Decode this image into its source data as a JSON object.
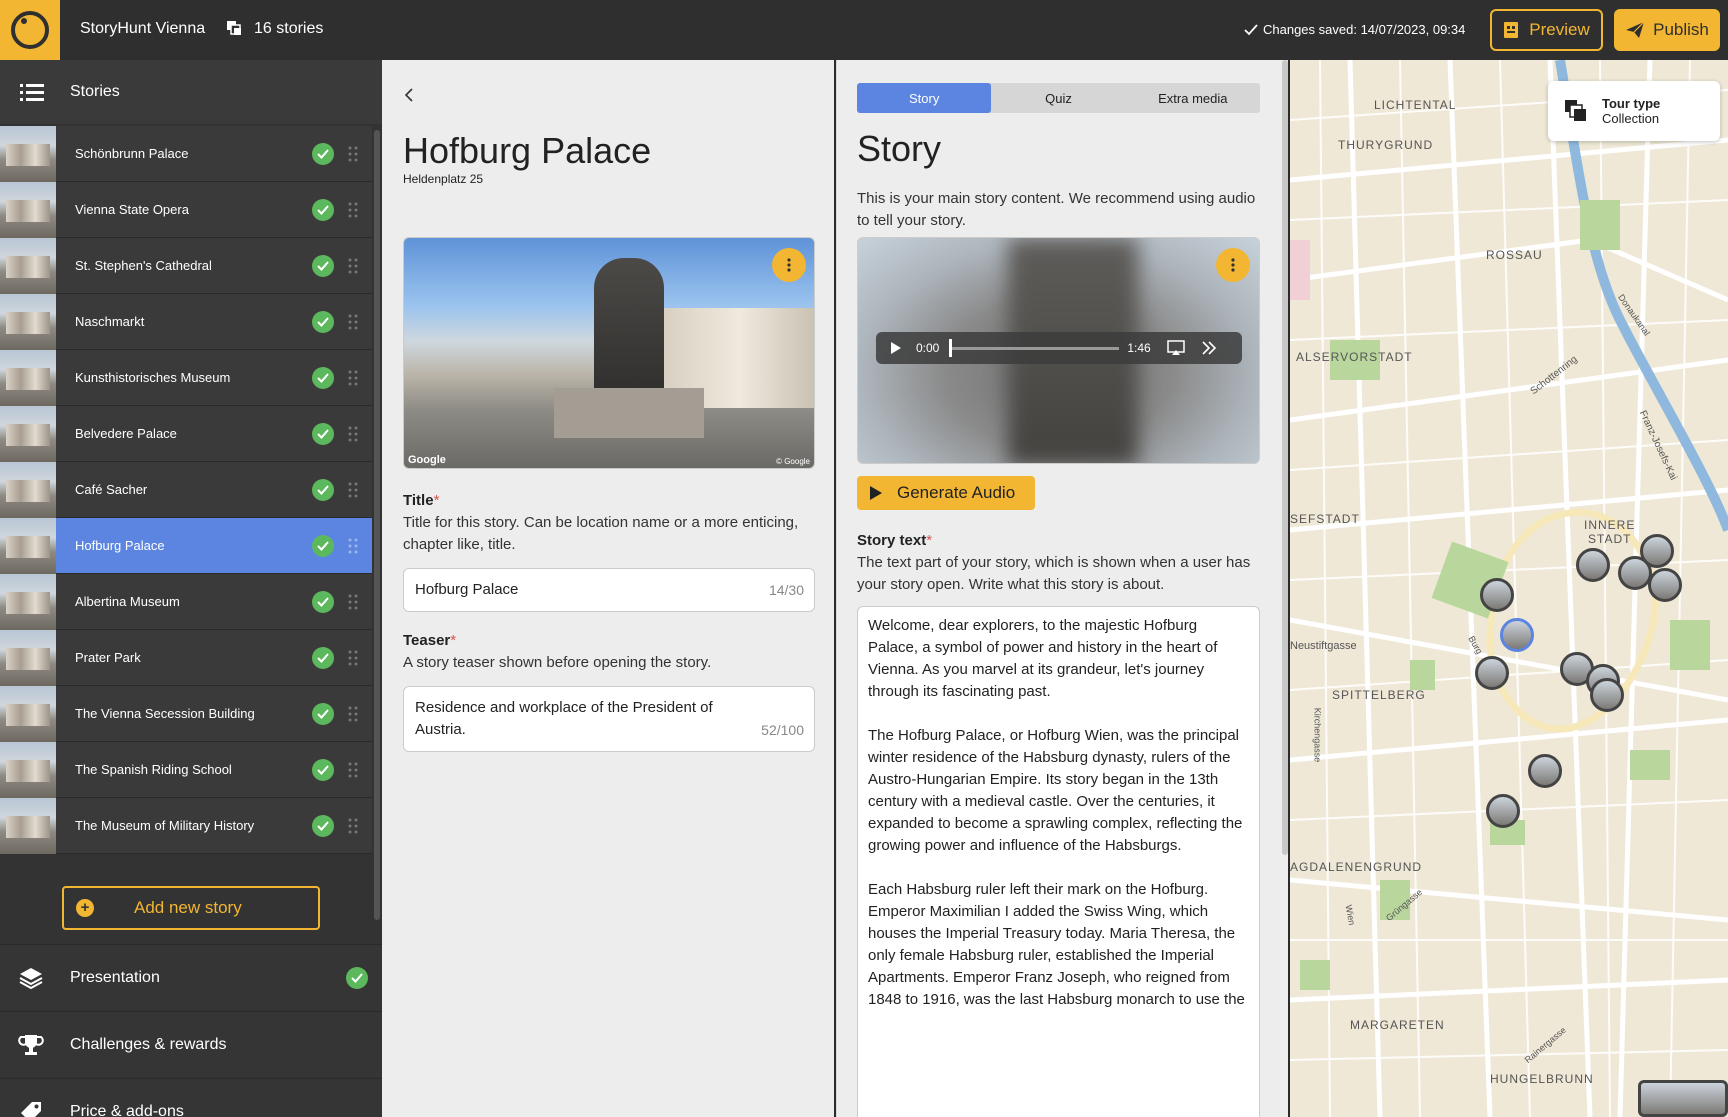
{
  "topbar": {
    "app_title": "StoryHunt Vienna",
    "stories_count": "16 stories",
    "saved_status": "Changes saved: 14/07/2023, 09:34",
    "preview_label": "Preview",
    "publish_label": "Publish",
    "accent_color": "#f2b632"
  },
  "sidebar": {
    "header": "Stories",
    "stories": [
      {
        "name": "Schönbrunn Palace",
        "active": false
      },
      {
        "name": "Vienna State Opera",
        "active": false
      },
      {
        "name": "St. Stephen's Cathedral",
        "active": false
      },
      {
        "name": "Naschmarkt",
        "active": false
      },
      {
        "name": "Kunsthistorisches Museum",
        "active": false
      },
      {
        "name": "Belvedere Palace",
        "active": false
      },
      {
        "name": "Café Sacher",
        "active": false
      },
      {
        "name": "Hofburg Palace",
        "active": true
      },
      {
        "name": "Albertina Museum",
        "active": false
      },
      {
        "name": "Prater Park",
        "active": false
      },
      {
        "name": "The Vienna Secession Building",
        "active": false
      },
      {
        "name": "The Spanish Riding School",
        "active": false
      },
      {
        "name": "The Museum of Military History",
        "active": false
      }
    ],
    "add_story_label": "Add new story",
    "sections": [
      {
        "label": "Presentation",
        "icon": "layers-icon",
        "done": true
      },
      {
        "label": "Challenges & rewards",
        "icon": "trophy-icon",
        "done": false
      },
      {
        "label": "Price & add-ons",
        "icon": "tag-icon",
        "done": false
      }
    ]
  },
  "editor": {
    "title": "Hofburg Palace",
    "address": "Heldenplatz 25",
    "photo_credit": "Google",
    "photo_copyright": "© Google",
    "title_field": {
      "label": "Title",
      "help": "Title for this story. Can be location name or a more enticing, chapter like, title.",
      "value": "Hofburg Palace",
      "counter": "14/30"
    },
    "teaser_field": {
      "label": "Teaser",
      "help": "A story teaser shown before opening the story.",
      "value": "Residence and workplace of the President of Austria.",
      "counter": "52/100"
    }
  },
  "story": {
    "tabs": [
      "Story",
      "Quiz",
      "Extra media"
    ],
    "active_tab": "Story",
    "heading": "Story",
    "help": "This is your main story content. We recommend using audio to tell your story.",
    "player": {
      "current": "0:00",
      "duration": "1:46"
    },
    "generate_audio_label": "Generate Audio",
    "text_field": {
      "label": "Story text",
      "help": "The text part of your story, which is shown when a user has your story open. Write what this story is about.",
      "paragraphs": [
        "Welcome, dear explorers, to the majestic Hofburg Palace, a symbol of power and history in the heart of Vienna. As you marvel at its grandeur, let's journey through its fascinating past.",
        "The Hofburg Palace, or Hofburg Wien, was the principal winter residence of the Habsburg dynasty, rulers of the Austro-Hungarian Empire. Its story began in the 13th century with a medieval castle. Over the centuries, it expanded to become a sprawling complex, reflecting the growing power and influence of the Habsburgs.",
        "Each Habsburg ruler left their mark on the Hofburg. Emperor Maximilian I added the Swiss Wing, which houses the Imperial Treasury today. Maria Theresa, the only female Habsburg ruler, established the Imperial Apartments. Emperor Franz Joseph, who reigned from 1848 to 1916, was the last Habsburg monarch to use the"
      ]
    }
  },
  "map": {
    "tour_type_label": "Tour type",
    "tour_type_value": "Collection",
    "districts": [
      "LICHTENTAL",
      "THURYGRUND",
      "ROSSAU",
      "ALSERVORSTADT",
      "SEFSTADT",
      "INNERE",
      "STADT",
      "SPITTELBERG",
      "AGDALENENGRUND",
      "MARGARETEN",
      "HUNGELBRUNN",
      "Neustiftgasse",
      "Schottenring",
      "Franz-Josefs-Kai",
      "Donaukanal",
      "Kirchengasse",
      "Burg",
      "Wien",
      "Grüngasse",
      "Rainergasse"
    ]
  }
}
